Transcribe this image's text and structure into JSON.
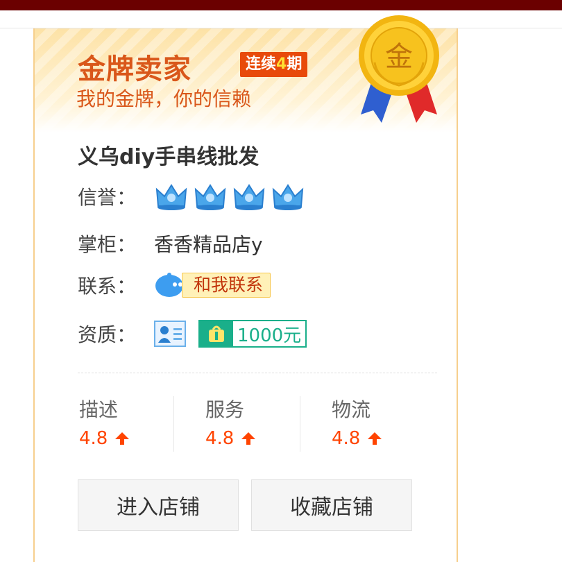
{
  "header": {
    "title": "金牌卖家",
    "periods_prefix": "连续",
    "periods_number": "4",
    "periods_suffix": "期",
    "subtitle": "我的金牌，你的信赖",
    "medal_char": "金"
  },
  "shop": {
    "name": "义乌diy手串线批发"
  },
  "credit": {
    "label": "信誉：",
    "crowns": 4,
    "crown_color": "#4aa6ea"
  },
  "keeper": {
    "label": "掌柜：",
    "value": "香香精品店y"
  },
  "contact": {
    "label": "联系：",
    "button": "和我联系"
  },
  "qualification": {
    "label": "资质：",
    "deposit": "1000元"
  },
  "scores": [
    {
      "label": "描述",
      "value": "4.8"
    },
    {
      "label": "服务",
      "value": "4.8"
    },
    {
      "label": "物流",
      "value": "4.8"
    }
  ],
  "actions": {
    "enter_shop": "进入店铺",
    "favorite_shop": "收藏店铺"
  },
  "colors": {
    "accent": "#d9571a",
    "score": "#ff4400",
    "deposit": "#1aaf8a",
    "border": "#f6cf8d"
  }
}
